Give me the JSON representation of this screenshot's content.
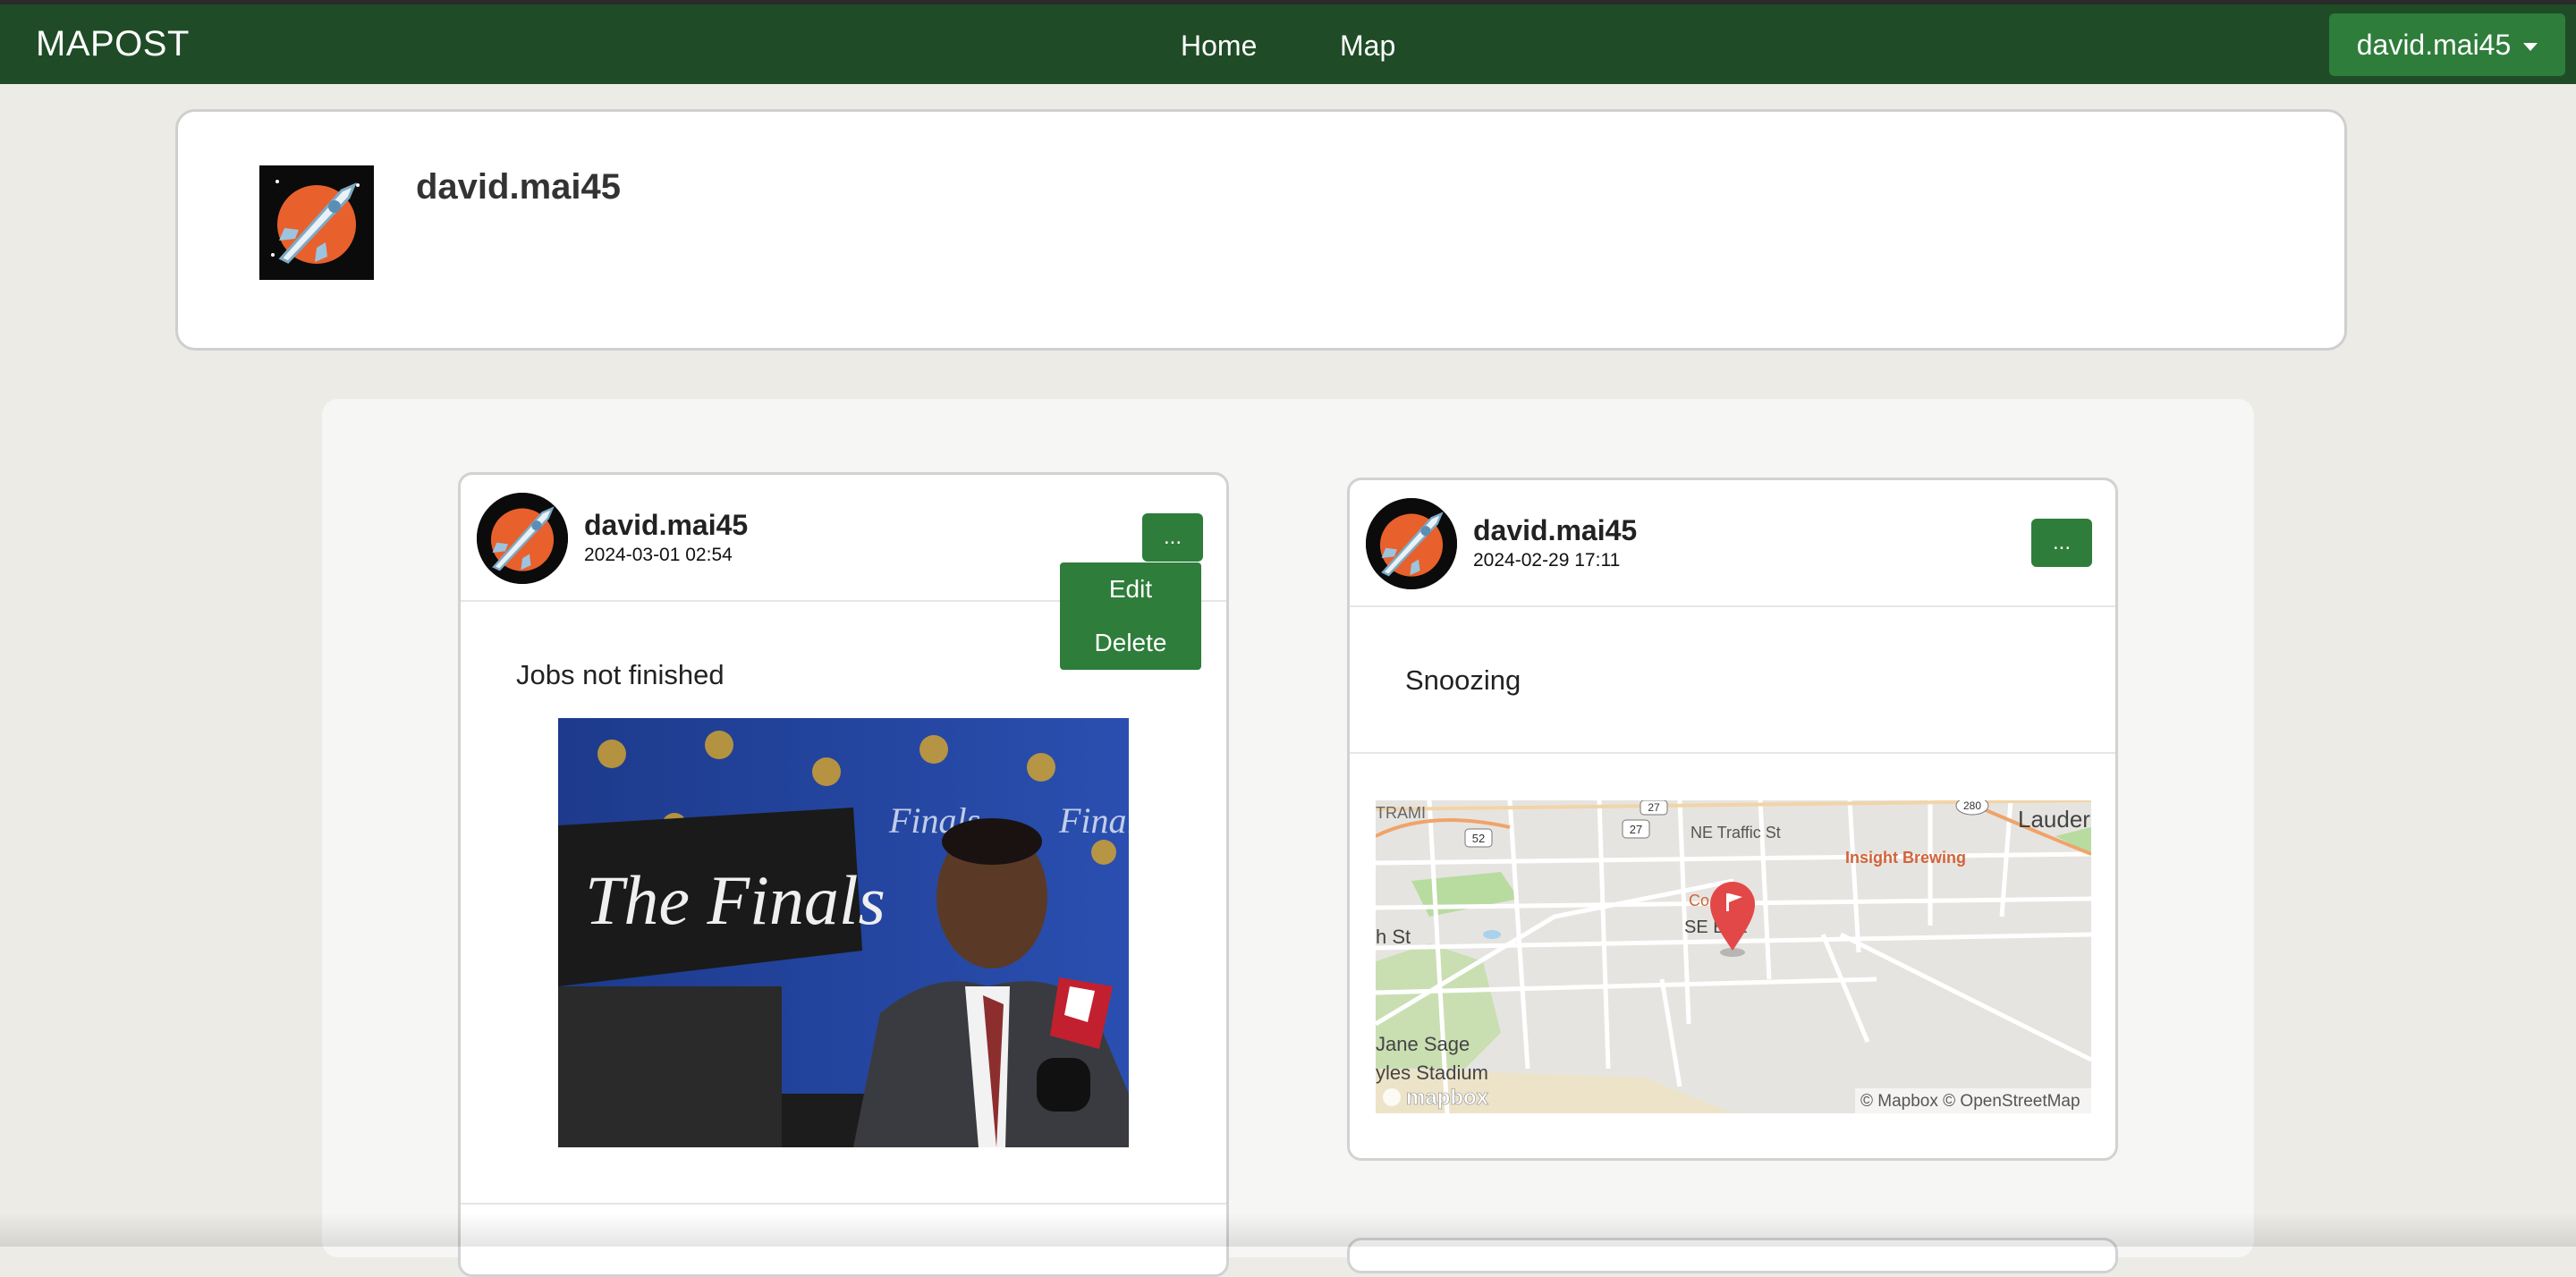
{
  "navbar": {
    "brand": "MAPOST",
    "links": [
      {
        "label": "Home"
      },
      {
        "label": "Map"
      }
    ],
    "user_menu": {
      "label": "david.mai45",
      "icon": "caret-down-icon"
    }
  },
  "profile": {
    "username": "david.mai45",
    "avatar": "rocket-avatar-icon"
  },
  "posts": [
    {
      "author": "david.mai45",
      "date": "2024-03-01 02:54",
      "more_label": "...",
      "menu": {
        "open": true,
        "items": [
          {
            "label": "Edit"
          },
          {
            "label": "Delete"
          }
        ]
      },
      "text": "Jobs not finished",
      "media": {
        "type": "photo",
        "sign_text": "The Finals",
        "backdrop_text": "Finals"
      }
    },
    {
      "author": "david.mai45",
      "date": "2024-02-29 17:11",
      "more_label": "...",
      "text": "Snoozing",
      "media": {
        "type": "map",
        "labels": {
          "street1": "NE Traffic St",
          "street2": "SE E St",
          "place1": "Insight Brewing",
          "place2": "Lauder",
          "place3": "Jane Sage",
          "place4": "yles Stadium",
          "place5": "TRAMI",
          "place6": "h St",
          "route1": "52",
          "route2": "27",
          "route3": "27",
          "route4": "280",
          "poi": "Co    op"
        },
        "logo": "mapbox",
        "attribution": "© Mapbox © OpenStreetMap"
      }
    }
  ]
}
